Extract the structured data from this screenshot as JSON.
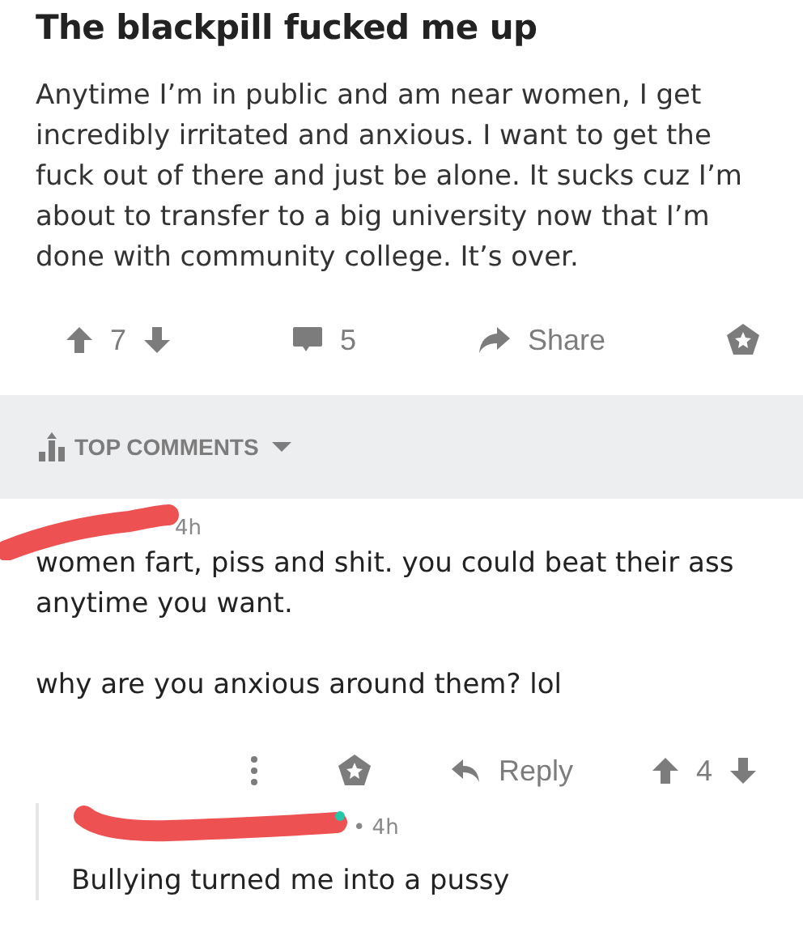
{
  "post": {
    "title": "The blackpill fucked me up",
    "body": "Anytime I’m in public and am near women, I get incredibly irritated and anxious. I want to get the fuck out of there and just be alone. It sucks cuz I’m about to transfer to a big university now that I’m done with community college. It’s over.",
    "score": "7",
    "comments": "5",
    "share": "Share"
  },
  "sort": {
    "label": "TOP COMMENTS"
  },
  "comments": [
    {
      "time": "4h",
      "body": "women fart, piss and shit. you could beat their ass anytime you want.\n\nwhy are you anxious around them? lol",
      "reply": "Reply",
      "score": "4",
      "replies": [
        {
          "time": "• 4h",
          "body": "Bullying turned me into a pussy"
        }
      ]
    }
  ]
}
